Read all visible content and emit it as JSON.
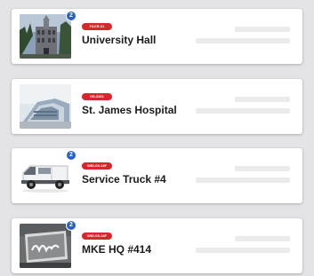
{
  "cards": [
    {
      "name": "University Hall",
      "tag": "FACR-01",
      "count": "2",
      "thumbnail_icon": "building-photo"
    },
    {
      "name": "St. James Hospital",
      "tag": "HS-2201",
      "count": "",
      "thumbnail_icon": "hospital-photo"
    },
    {
      "name": "Service Truck #4",
      "tag": "WID-03-14F",
      "count": "2",
      "thumbnail_icon": "van-photo"
    },
    {
      "name": "MKE HQ #414",
      "tag": "WID-03-14F",
      "count": "2",
      "thumbnail_icon": "headquarters-sign-photo"
    }
  ],
  "colors": {
    "tag_red": "#d7262c",
    "badge_blue": "#2a61c9",
    "page_background": "#e4e4e6"
  }
}
